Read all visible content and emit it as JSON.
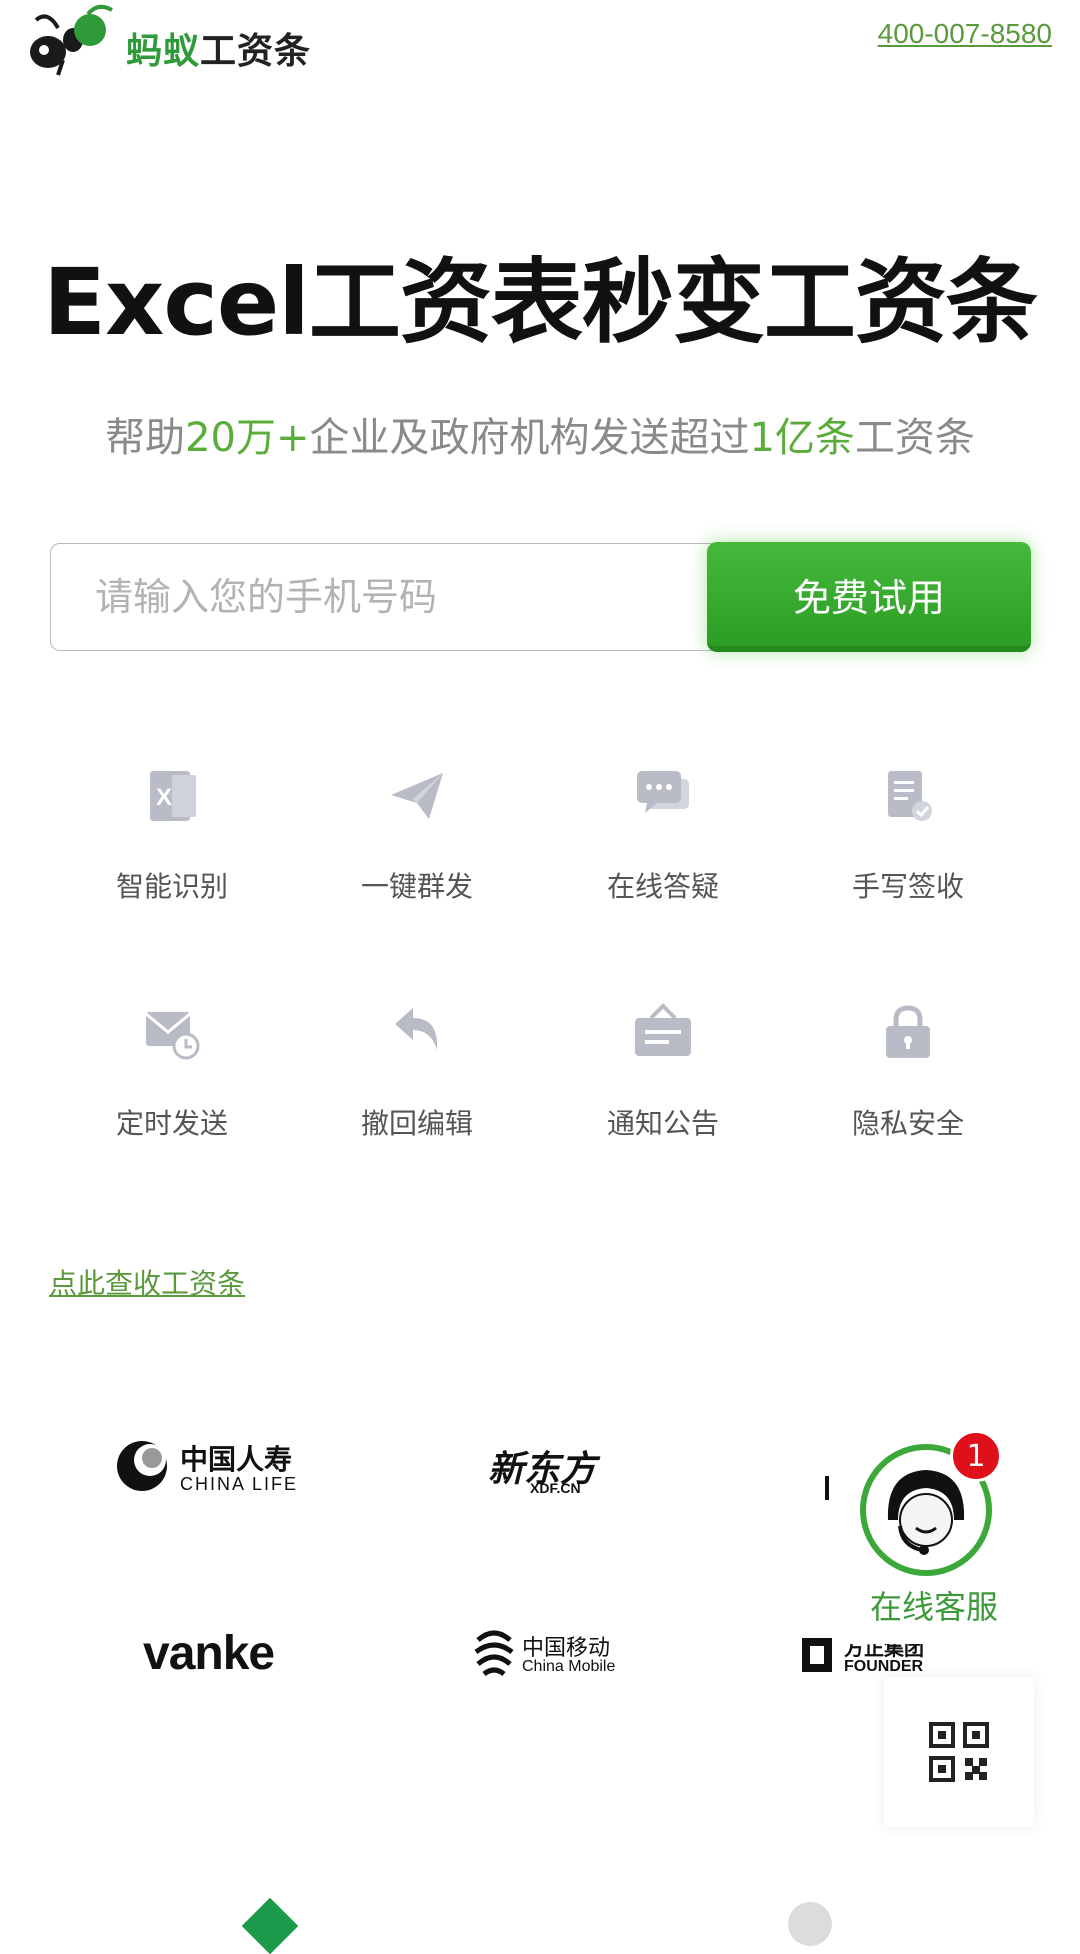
{
  "header": {
    "brand_green": "蚂蚁",
    "brand_dark": "工资条",
    "phone": "400-007-8580"
  },
  "hero": {
    "title": "Excel工资表秒变工资条",
    "subtitle_1": "帮助",
    "subtitle_hl1": "20万+",
    "subtitle_2": "企业及政府机构发送超过",
    "subtitle_hl2": "1亿条",
    "subtitle_3": "工资条"
  },
  "signup": {
    "placeholder": "请输入您的手机号码",
    "button": "免费试用"
  },
  "features": [
    {
      "icon": "excel-icon",
      "label": "智能识别"
    },
    {
      "icon": "paper-plane-icon",
      "label": "一键群发"
    },
    {
      "icon": "chat-bubbles-icon",
      "label": "在线答疑"
    },
    {
      "icon": "signed-document-icon",
      "label": "手写签收"
    },
    {
      "icon": "scheduled-mail-icon",
      "label": "定时发送"
    },
    {
      "icon": "undo-icon",
      "label": "撤回编辑"
    },
    {
      "icon": "notice-board-icon",
      "label": "通知公告"
    },
    {
      "icon": "lock-icon",
      "label": "隐私安全"
    }
  ],
  "check_link": "点此查收工资条",
  "partners": {
    "china_life_cn": "中国人寿",
    "china_life_en": "CHINA LIFE",
    "xdf_cn": "新东方",
    "xdf_en": "XDF.CN",
    "vanke": "vanke",
    "cmcc_cn": "中国移动",
    "cmcc_en": "China Mobile",
    "founder_cn": "方正集团",
    "founder_en": "FOUNDER"
  },
  "service": {
    "badge": "1",
    "label": "在线客服"
  },
  "colors": {
    "accent": "#3da83a",
    "link": "#5a9a3c",
    "icon_gray": "#b9bcc6"
  }
}
